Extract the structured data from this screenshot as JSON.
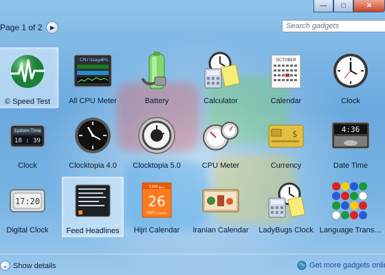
{
  "window": {
    "minimize_glyph": "—",
    "maximize_glyph": "□",
    "close_glyph": "✕"
  },
  "pager": {
    "label": "Page 1 of 2",
    "next_glyph": "▶"
  },
  "search": {
    "placeholder": "Search gadgets"
  },
  "gadgets": [
    {
      "label": "© Speed Test",
      "icon": "speed-test-globe-icon",
      "selected": true
    },
    {
      "label": "All CPU Meter",
      "icon": "cpu-meter-screen-icon",
      "selected": false
    },
    {
      "label": "Battery",
      "icon": "battery-icon",
      "selected": false
    },
    {
      "label": "Calculator",
      "icon": "calculator-icon",
      "selected": false
    },
    {
      "label": "Calendar",
      "icon": "calendar-icon",
      "selected": false
    },
    {
      "label": "Clock",
      "icon": "clock-icon",
      "selected": false
    },
    {
      "label": "Clock",
      "icon": "digital-clock-dark-icon",
      "selected": false
    },
    {
      "label": "Clocktopia 4.0",
      "icon": "black-watch-icon",
      "selected": false
    },
    {
      "label": "Clocktopia 5.0",
      "icon": "chrome-watch-icon",
      "selected": false
    },
    {
      "label": "CPU Meter",
      "icon": "cpu-gauge-icon",
      "selected": false
    },
    {
      "label": "Currency",
      "icon": "currency-card-icon",
      "selected": false
    },
    {
      "label": "Date Time",
      "icon": "date-time-display-icon",
      "selected": false
    },
    {
      "label": "Digital Clock",
      "icon": "lcd-clock-icon",
      "selected": false
    },
    {
      "label": "Feed Headlines",
      "icon": "feed-headlines-icon",
      "selected": false
    },
    {
      "label": "Hijri Calendar",
      "icon": "hijri-calendar-icon",
      "selected": false
    },
    {
      "label": "Iranian Calendar",
      "icon": "iranian-calendar-icon",
      "selected": false
    },
    {
      "label": "LadyBugs Clock",
      "icon": "ladybugs-clock-icon",
      "selected": false
    },
    {
      "label": "Language Trans…",
      "icon": "flags-icon",
      "selected": false
    }
  ],
  "icon_text": {
    "cpu_title": "CPU Usage",
    "cpu_value": "6%",
    "calendar_month": "OCTOBER",
    "system_time": "System Time",
    "system_time_value": "18 : 39",
    "date_time_value": "4:36",
    "digital_clock_value": "17:20",
    "hijri_day": "26",
    "hijri_top": "1390 ربيع",
    "hijri_bottom": "2007 ديسمبر",
    "currency_symbol": "$"
  },
  "bottom": {
    "show_details": "Show details",
    "get_more": "Get more gadgets online"
  },
  "colors": {
    "background_top": "#8fc3ea",
    "link": "#1a4c9a",
    "selection": "#e6f4ff"
  }
}
